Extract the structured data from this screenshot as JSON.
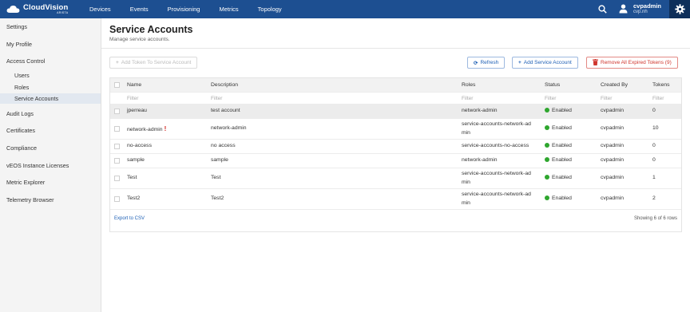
{
  "topbar": {
    "brand": "CloudVision",
    "brand_sub": "ARISTA",
    "nav": [
      "Devices",
      "Events",
      "Provisioning",
      "Metrics",
      "Topology"
    ],
    "user_name": "cvpadmin",
    "user_host": "cvp.nh",
    "icons": [
      "search-icon",
      "user-icon",
      "gear-icon"
    ]
  },
  "sidebar": {
    "items": [
      {
        "label": "Settings"
      },
      {
        "label": "My Profile"
      },
      {
        "label": "Access Control"
      },
      {
        "label": "Users"
      },
      {
        "label": "Roles"
      },
      {
        "label": "Service Accounts"
      },
      {
        "label": "Audit Logs"
      },
      {
        "label": "Certificates"
      },
      {
        "label": "Compliance"
      },
      {
        "label": "vEOS Instance Licenses"
      },
      {
        "label": "Metric Explorer"
      },
      {
        "label": "Telemetry Browser"
      }
    ]
  },
  "page": {
    "title": "Service Accounts",
    "subtitle": "Manage service accounts."
  },
  "toolbar": {
    "add_token": "Add Token To Service Account",
    "refresh": "Refresh",
    "add_account": "Add Service Account",
    "remove_expired": "Remove All Expired Tokens (9)"
  },
  "table": {
    "headers": [
      "Name",
      "Description",
      "Roles",
      "Status",
      "Created By",
      "Tokens"
    ],
    "filter_placeholder": "Filter",
    "rows": [
      {
        "name": "jperreau",
        "description": "test account",
        "roles": "network-admin",
        "roles2": "",
        "status": "Enabled",
        "created_by": "cvpadmin",
        "tokens": "0",
        "warn": ""
      },
      {
        "name": "network-admin",
        "description": "network-admin",
        "roles": "service-accounts-network-ad",
        "roles2": "min",
        "status": "Enabled",
        "created_by": "cvpadmin",
        "tokens": "10",
        "warn": "!"
      },
      {
        "name": "no-access",
        "description": "no access",
        "roles": "service-accounts-no-access",
        "roles2": "",
        "status": "Enabled",
        "created_by": "cvpadmin",
        "tokens": "0",
        "warn": ""
      },
      {
        "name": "sample",
        "description": "sample",
        "roles": "network-admin",
        "roles2": "",
        "status": "Enabled",
        "created_by": "cvpadmin",
        "tokens": "0",
        "warn": ""
      },
      {
        "name": "Test",
        "description": "Test",
        "roles": "service-accounts-network-ad",
        "roles2": "min",
        "status": "Enabled",
        "created_by": "cvpadmin",
        "tokens": "1",
        "warn": ""
      },
      {
        "name": "Test2",
        "description": "Test2",
        "roles": "service-accounts-network-ad",
        "roles2": "min",
        "status": "Enabled",
        "created_by": "cvpadmin",
        "tokens": "2",
        "warn": ""
      }
    ],
    "export": "Export to CSV",
    "showing": "Showing 6 of 6 rows"
  },
  "colors": {
    "topbar": "#1d4f91",
    "accent": "#1d5fb5",
    "danger": "#d0352d",
    "enabled": "#2ea62e"
  }
}
